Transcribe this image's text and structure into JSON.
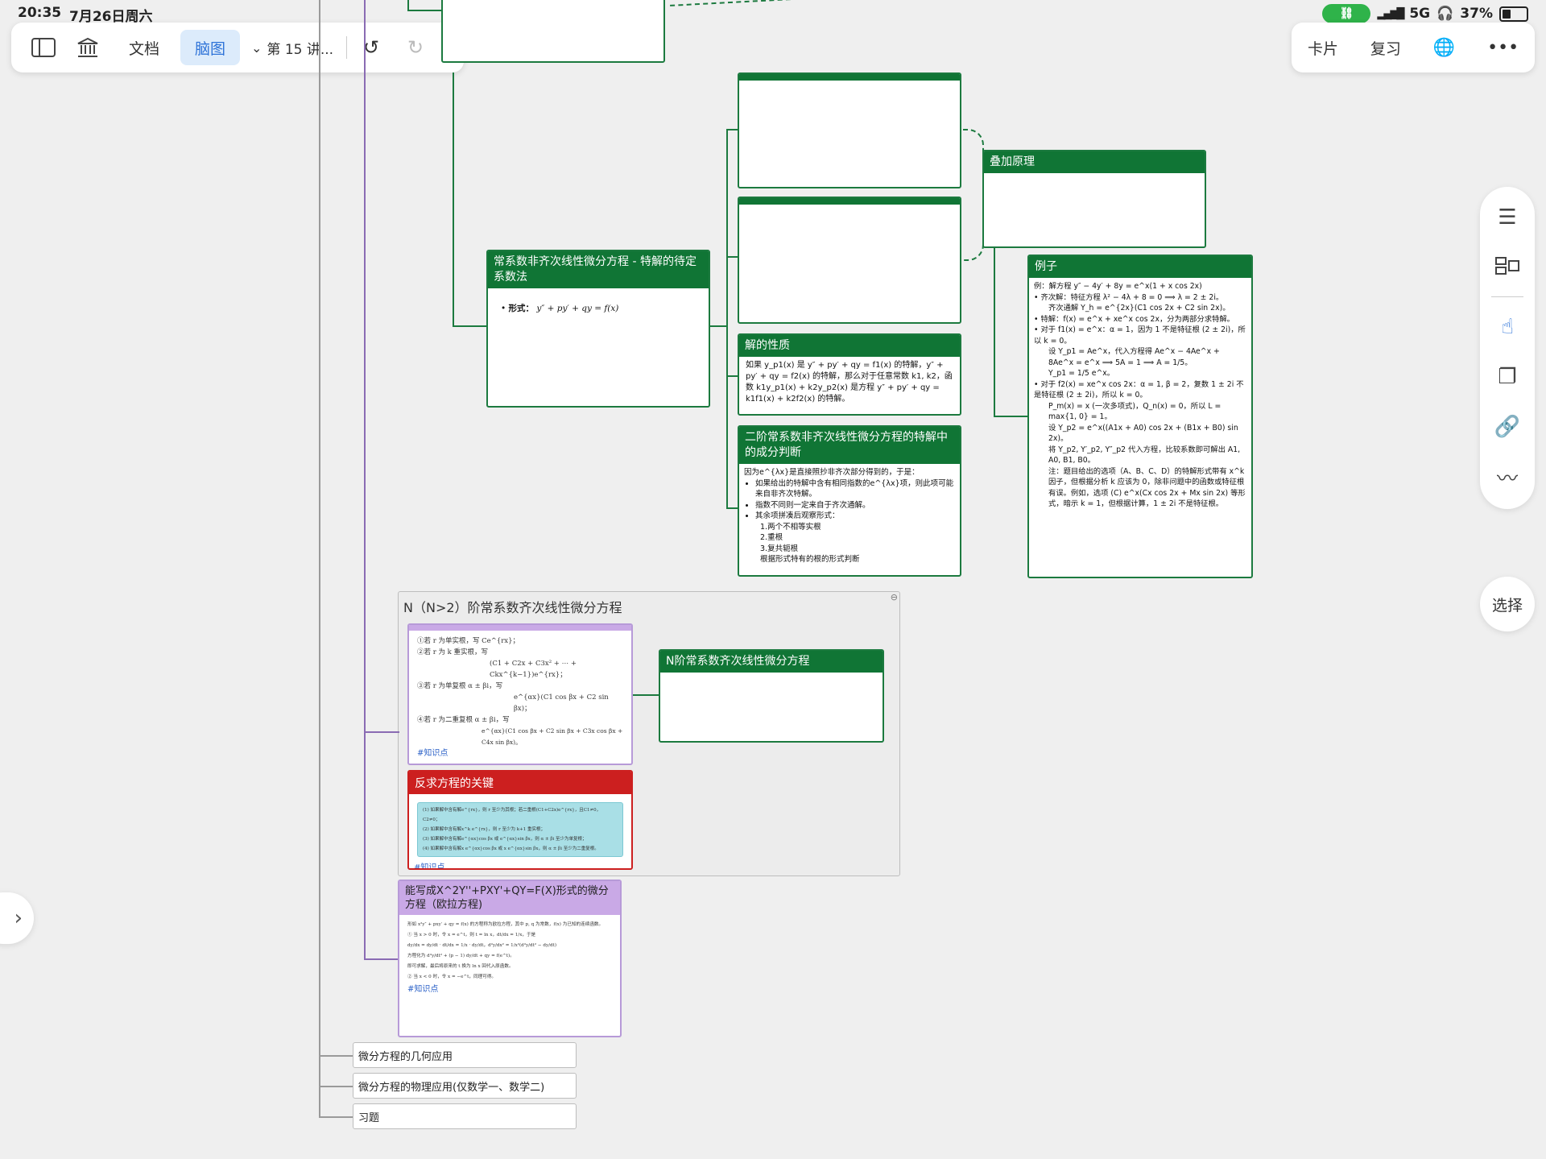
{
  "status_bar": {
    "time": "20:35",
    "date": "7月26日周六",
    "network": "5G",
    "battery": "37%"
  },
  "toolbar": {
    "doc": "文档",
    "mindmap": "脑图",
    "title": "第 15 讲...",
    "card": "卡片",
    "review": "复习"
  },
  "side": {
    "select": "选择"
  },
  "nodes": {
    "superposition": {
      "title": "叠加原理"
    },
    "nonhomog": {
      "title": "常系数非齐次线性微分方程 - 特解的待定系数法",
      "form_label": "形式：",
      "form": "y″ + py′ + qy = f(x)"
    },
    "solution_props": {
      "title": "解的性质",
      "text": "如果 y_p1(x) 是 y″ + py′ + qy = f1(x) 的特解，y″ + py′ + qy = f2(x) 的特解，那么对于任意常数 k1, k2，函数 k1y_p1(x) + k2y_p2(x) 是方程 y″ + py′ + qy = k1f1(x) + k2f2(x) 的特解。"
    },
    "judge": {
      "title": "二阶常系数非齐次线性微分方程的特解中的成分判断",
      "intro": "因为e^{λx}是直接照抄非齐次部分得到的，于是：",
      "items": [
        "如果给出的特解中含有相同指数的e^{λx}项，则此项可能来自非齐次特解。",
        "指数不同则一定来自于齐次通解。",
        "其余项拼凑后观察形式："
      ],
      "sub": [
        "1.两个不相等实根",
        "2.重根",
        "3.复共轭根",
        "根据形式特有的根的形式判断"
      ]
    },
    "example": {
      "title": "例子",
      "lines": [
        "例：解方程 y″ − 4y′ + 8y = e^x(1 + x cos 2x)",
        "• 齐次解：特征方程 λ² − 4λ + 8 = 0 ⟹ λ = 2 ± 2i。",
        "齐次通解 Y_h = e^{2x}(C1 cos 2x + C2 sin 2x)。",
        "• 特解：f(x) = e^x + xe^x cos 2x，分为两部分求特解。",
        "• 对于 f1(x) = e^x：α = 1，因为 1 不是特征根 (2 ± 2i)，所以 k = 0。",
        "设 Y_p1 = Ae^x，代入方程得 Ae^x − 4Ae^x + 8Ae^x = e^x ⟹ 5A = 1 ⟹ A = 1/5。",
        "Y_p1 = 1/5 e^x。",
        "• 对于 f2(x) = xe^x cos 2x：α = 1, β = 2，复数 1 ± 2i 不是特征根 (2 ± 2i)，所以 k = 0。",
        "P_m(x) = x (一次多项式)，Q_n(x) = 0，所以 L = max{1, 0} = 1。",
        "设 Y_p2 = e^x((A1x + A0) cos 2x + (B1x + B0) sin 2x)。",
        "将 Y_p2, Y′_p2, Y″_p2 代入方程，比较系数即可解出 A1, A0, B1, B0。",
        "注：题目给出的选项（A、B、C、D）的特解形式带有 x^k 因子，但根据分析 k 应该为 0，除非问题中的函数或特征根有误。例如，选项 (C) e^x(Cx cos 2x + Mx sin 2x) 等形式，暗示 k = 1，但根据计算，1 ± 2i 不是特征根。"
      ]
    },
    "n_order_group": {
      "title": "N（N>2）阶常系数齐次线性微分方程"
    },
    "n_order_node": {
      "title": "N阶常系数齐次线性微分方程"
    },
    "roots_card": {
      "lines": [
        "①若 r 为单实根，写 Ce^{rx}；",
        "②若 r 为 k 重实根，写",
        "(C1 + C2x + C3x² + ⋯ + Ckx^{k−1})e^{rx}；",
        "③若 r 为单复根 α ± βi，写",
        "e^{αx}(C1 cos βx + C2 sin βx)；",
        "④若 r 为二重复根 α ± βi，写",
        "e^{αx}(C1 cos βx + C2 sin βx + C3x cos βx + C4x sin βx)。"
      ],
      "tag": "#知识点"
    },
    "reverse": {
      "title": "反求方程的关键",
      "lines": [
        "(1) 如果解中含有解e^{rx}，则 r 至少为其根；若二重根(C1+C2x)e^{rx}，且C1≠0，C2≠0；",
        "(2) 如果解中含有解x^k e^{rx}，则 r 至少为 k+1 重实根；",
        "(3) 如果解中含有解e^{αx}cos βx 或 e^{αx}sin βx，则 α ± βi 至少为单复根；",
        "(4) 如果解中含有解x e^{αx}cos βx 或 x e^{αx}sin βx，则 α ± βi 至少为二重复根。"
      ],
      "tag": "#知识点"
    },
    "euler": {
      "title": "能写成X^2Y''+PXY'+QY=F(X)形式的微分方程（欧拉方程)",
      "lines": [
        "形如 x²y″ + pxy′ + qy = f(x) 的方程称为欧拉方程，其中 p, q 为常数，f(x) 为已知的连续函数。",
        "① 当 x > 0 时，令 x = e^t，则 t = ln x，dt/dx = 1/x，于是",
        "dy/dx = dy/dt · dt/dx = 1/x · dy/dt，d²y/dx² = 1/x²(d²y/dt² − dy/dt)",
        "方程化为 d²y/dt² + (p − 1) dy/dt + qy = f(e^t)。",
        "即可求解，最后将原来的 t 换为 ln x 回代入原函数。",
        "② 当 x < 0 时，令 x = −e^t，同理可得。"
      ],
      "tag": "#知识点"
    },
    "leaves": [
      "微分方程的几何应用",
      "微分方程的物理应用(仅数学一、数学二)",
      "习题"
    ]
  }
}
